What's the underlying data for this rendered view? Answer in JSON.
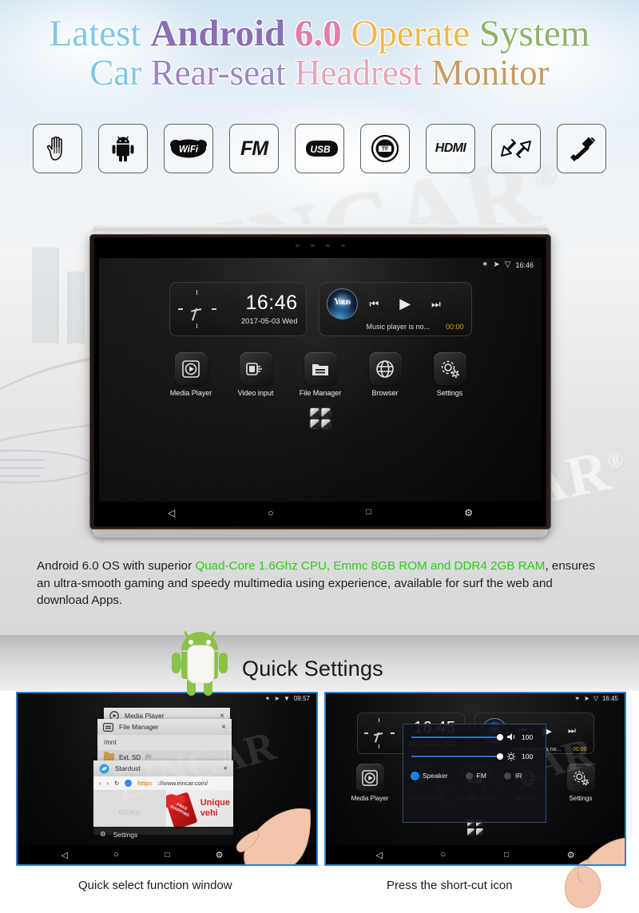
{
  "title": {
    "line1": [
      {
        "t": "Latest ",
        "c": "#7ec8e8",
        "b": false
      },
      {
        "t": "Android ",
        "c": "#8a6fb5",
        "b": true
      },
      {
        "t": "6.0 ",
        "c": "#e07fa8",
        "b": true
      },
      {
        "t": "Operate ",
        "c": "#f2b84b",
        "b": false
      },
      {
        "t": "System",
        "c": "#8fb36b",
        "b": false
      }
    ],
    "line2": [
      {
        "t": "Car ",
        "c": "#7ec8e8",
        "b": false
      },
      {
        "t": "Rear-seat ",
        "c": "#9d86c4",
        "b": false
      },
      {
        "t": "Headrest ",
        "c": "#e8a6b8",
        "b": false
      },
      {
        "t": "Monitor",
        "c": "#c79a63",
        "b": false
      }
    ]
  },
  "feature_icons": [
    {
      "name": "touch-hand-icon",
      "label": "Touch"
    },
    {
      "name": "android-robot-icon",
      "label": "Android"
    },
    {
      "name": "wifi-icon",
      "label": "Wi-Fi"
    },
    {
      "name": "fm-icon",
      "label": "FM"
    },
    {
      "name": "usb-icon",
      "label": "USB"
    },
    {
      "name": "tf-card-icon",
      "label": "TF"
    },
    {
      "name": "hdmi-icon",
      "label": "HDMI"
    },
    {
      "name": "two-arrows-icon",
      "label": "Transfer"
    },
    {
      "name": "av-cable-icon",
      "label": "AV"
    }
  ],
  "watermark": {
    "text": "EINCAR",
    "registered": "®",
    "shot_text": "EINCAR"
  },
  "device_screen": {
    "statusbar": {
      "bluetooth": "✶",
      "cast": "➤",
      "wifi": "▽",
      "time": "16:46"
    },
    "clock_widget": {
      "time": "16:46",
      "date": "2017-05-03  Wed"
    },
    "music_widget": {
      "album_label": "Yous",
      "prev": "⏮",
      "play": "▶",
      "next": "⏭",
      "title": "Music player is no...",
      "elapsed": "00:00"
    },
    "apps": [
      {
        "name": "media-player",
        "label": "Media Player",
        "glyph": "▶"
      },
      {
        "name": "video-input",
        "label": "Video input",
        "glyph": "▣"
      },
      {
        "name": "file-manager",
        "label": "File Manager",
        "glyph": "☰"
      },
      {
        "name": "browser",
        "label": "Browser",
        "glyph": "⊕"
      },
      {
        "name": "settings",
        "label": "Settings",
        "glyph": "⚙"
      }
    ],
    "navbar": [
      {
        "name": "back-button",
        "glyph": "◁"
      },
      {
        "name": "home-button",
        "glyph": "○"
      },
      {
        "name": "recents-button",
        "glyph": "□"
      },
      {
        "name": "quick-settings-button",
        "glyph": "⚙"
      }
    ]
  },
  "description": {
    "pre": "Android 6.0 OS with superior ",
    "highlight": "Quad-Core 1.6Ghz CPU, Emmc 8GB ROM and DDR4 2GB RAM",
    "post": ", ensures an ultra-smooth gaming and speedy multimedia using experience, available for surf the web and download Apps.",
    "highlight_color": "#2ecc17"
  },
  "quick_settings": {
    "heading": "Quick Settings"
  },
  "shot_left": {
    "statusbar": {
      "bluetooth": "✶",
      "cast": "➤",
      "wifi": "▼",
      "time": "09:57"
    },
    "windows": [
      {
        "name": "media-player-window",
        "title": "Media Player",
        "close": "×"
      },
      {
        "name": "file-manager-window",
        "title": "File Manager",
        "close": "×",
        "path": "/mnt",
        "file": "Ext. SD",
        "file_meta": "(0)"
      },
      {
        "name": "browser-window",
        "title": "Stardust",
        "close": "×",
        "back": "‹",
        "forward": "›",
        "reload": "↻",
        "scheme": "https",
        "url": "://www.eincar.com/",
        "menu_label": "MENU",
        "promo_line1": "Unique",
        "promo_line2": "vehi",
        "ribbon": "FREE SHIPPING"
      }
    ],
    "settings_row": {
      "label": "Settings",
      "glyph": "⚙"
    },
    "navbar": [
      {
        "name": "back-button",
        "glyph": "◁"
      },
      {
        "name": "home-button",
        "glyph": "○"
      },
      {
        "name": "recents-button",
        "glyph": "□"
      },
      {
        "name": "quick-settings-button",
        "glyph": "⚙"
      },
      {
        "name": "collapse-button",
        "glyph": "▾"
      }
    ],
    "caption": "Quick select function window"
  },
  "shot_right": {
    "statusbar": {
      "bluetooth": "✶",
      "cast": "➤",
      "wifi": "▽",
      "time": "16:45"
    },
    "clock_widget": {
      "time": "16:45",
      "date": "2017-05-03  Wed"
    },
    "music_widget": {
      "prev": "⏮",
      "play": "▶",
      "next": "⏭",
      "title": "Music player is no...",
      "elapsed": "00:00"
    },
    "overlay": {
      "volume": {
        "name": "volume-slider",
        "icon": "🔊",
        "value": "100"
      },
      "brightness": {
        "name": "brightness-slider",
        "icon": "☀",
        "value": "100"
      },
      "outputs": [
        {
          "name": "speaker-radio",
          "label": "Speaker",
          "selected": true
        },
        {
          "name": "fm-radio",
          "label": "FM",
          "selected": false
        },
        {
          "name": "ir-radio",
          "label": "IR",
          "selected": false
        }
      ]
    },
    "apps": [
      {
        "name": "media-player",
        "label": "Media Player",
        "glyph": "▶"
      },
      {
        "name": "video-input",
        "label": "Video input",
        "glyph": "▣"
      },
      {
        "name": "file-manager",
        "label": "File Manager",
        "glyph": "☰"
      },
      {
        "name": "browser",
        "label": "Browser",
        "glyph": "⊕"
      },
      {
        "name": "settings",
        "label": "Settings",
        "glyph": "⚙"
      }
    ],
    "navbar": [
      {
        "name": "back-button",
        "glyph": "◁"
      },
      {
        "name": "home-button",
        "glyph": "○"
      },
      {
        "name": "recents-button",
        "glyph": "□"
      },
      {
        "name": "quick-settings-button",
        "glyph": "⚙"
      }
    ],
    "caption": "Press the short-cut icon"
  },
  "colors": {
    "accent_blue": "#2e7fd4",
    "highlight_green": "#2ecc17",
    "android_green": "#7ac143",
    "amber": "#d5a41f"
  }
}
